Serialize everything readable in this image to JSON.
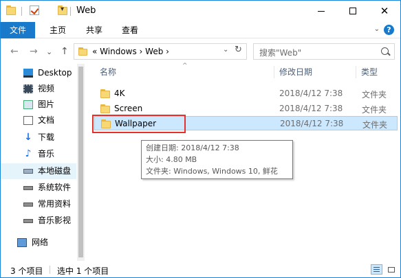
{
  "window": {
    "title": "Web",
    "quick_access_dropdown": "▾"
  },
  "ribbon": {
    "tabs": [
      {
        "label": "文件",
        "active": true
      },
      {
        "label": "主页"
      },
      {
        "label": "共享"
      },
      {
        "label": "查看"
      }
    ],
    "expand_glyph": "⌄",
    "help_glyph": "?"
  },
  "nav_buttons": {
    "back": "←",
    "forward": "→",
    "recent": "⌄",
    "up": "↑"
  },
  "address": {
    "path": "«  Windows  ›  Web  ›",
    "dropdown": "⌄",
    "refresh": "↻"
  },
  "search": {
    "placeholder": "搜索\"Web\""
  },
  "nav_pane": {
    "items": [
      {
        "label": "Desktop",
        "icon": "desktop-icon"
      },
      {
        "label": "视频",
        "icon": "video-icon"
      },
      {
        "label": "图片",
        "icon": "picture-icon"
      },
      {
        "label": "文档",
        "icon": "document-icon"
      },
      {
        "label": "下载",
        "icon": "download-icon"
      },
      {
        "label": "音乐",
        "icon": "music-icon"
      },
      {
        "label": "本地磁盘",
        "icon": "drive-icon",
        "selected": true
      },
      {
        "label": "系统软件",
        "icon": "drive-icon"
      },
      {
        "label": "常用资料",
        "icon": "drive-icon"
      },
      {
        "label": "音乐影视",
        "icon": "drive-icon"
      },
      {
        "label": "网络",
        "icon": "network-icon"
      }
    ]
  },
  "columns": {
    "name": "名称",
    "date": "修改日期",
    "type": "类型",
    "sort_glyph": "^"
  },
  "files": [
    {
      "name": "4K",
      "date": "2018/4/12 7:38",
      "type": "文件夹"
    },
    {
      "name": "Screen",
      "date": "2018/4/12 7:38",
      "type": "文件夹"
    },
    {
      "name": "Wallpaper",
      "date": "2018/4/12 7:38",
      "type": "文件夹",
      "selected": true
    }
  ],
  "tooltip": {
    "created": "创建日期: 2018/4/12 7:38",
    "size": "大小: 4.80 MB",
    "contents": "文件夹: Windows, Windows 10, 鲜花"
  },
  "status": {
    "item_count": "3 个项目",
    "selected": "选中 1 个项目"
  },
  "colors": {
    "accent": "#1979ca",
    "selection": "#cce8ff",
    "highlight_border": "#e3302a"
  }
}
